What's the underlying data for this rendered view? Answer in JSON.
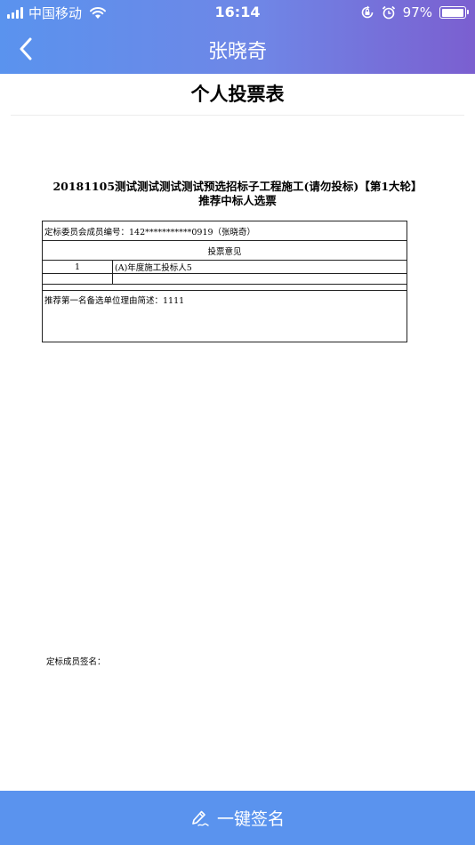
{
  "status_bar": {
    "carrier": "中国移动",
    "time": "16:14",
    "battery_percent": "97%",
    "battery_level": 0.97,
    "icons": [
      "signal-icon",
      "wifi-icon",
      "orientation-lock-icon",
      "alarm-icon",
      "battery-icon"
    ]
  },
  "nav": {
    "title": "张晓奇",
    "back_icon": "chevron-left-icon"
  },
  "page": {
    "heading": "个人投票表"
  },
  "document": {
    "title_line1": "20181105测试测试测试测试预选招标子工程施工(请勿投标)【第1大轮】",
    "title_line2": "推荐中标人选票",
    "member_info": "定标委员会成员编号：142***********0919（张晓奇）",
    "opinion_header": "投票意见",
    "rows": [
      {
        "rank": "1",
        "candidate": "(A)年度施工投标人5"
      }
    ],
    "reason": "推荐第一名备选单位理由简述：1111",
    "signature_label": "定标成员签名："
  },
  "actions": {
    "sign_button_label": "一键签名",
    "sign_icon": "signature-pen-icon"
  },
  "colors": {
    "header_gradient_start": "#5a93ee",
    "header_gradient_end": "#7b5fd0",
    "button_bg": "#5a93ee"
  }
}
